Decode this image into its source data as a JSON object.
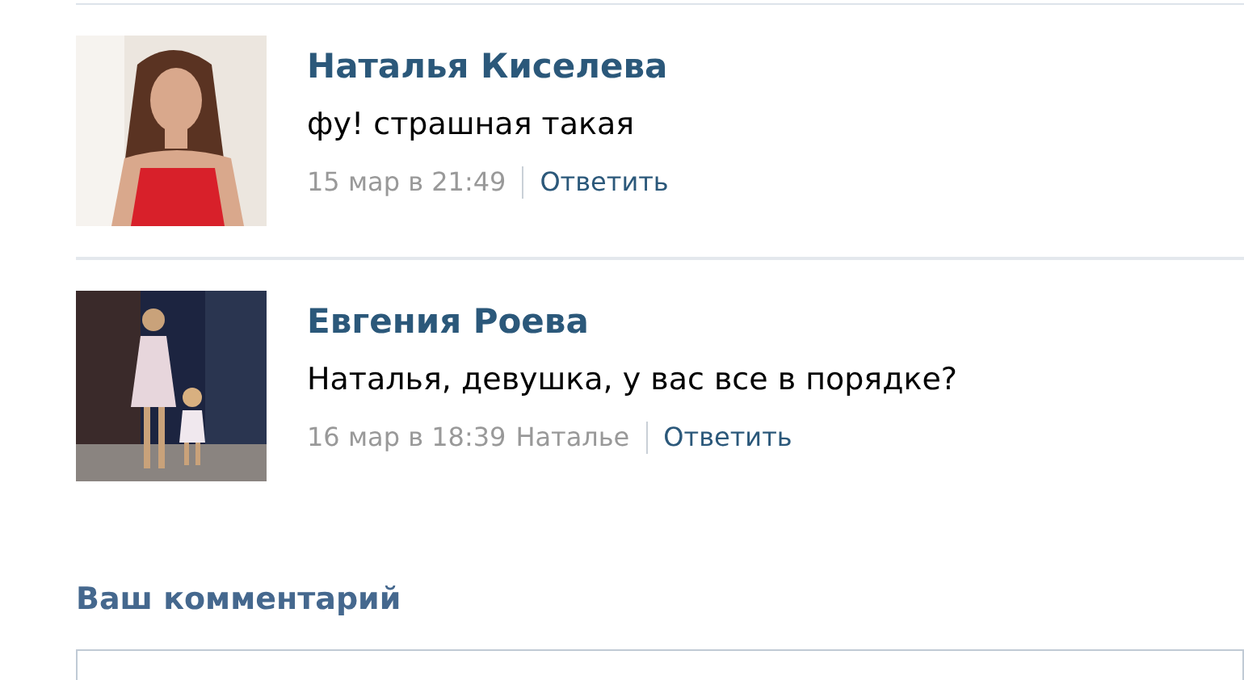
{
  "comments": [
    {
      "author": "Наталья Киселева",
      "text": "фу! страшная такая",
      "date": "15 мар в 21:49",
      "reply_label": "Ответить"
    },
    {
      "author": "Евгения Роева",
      "text": "Наталья, девушка, у вас все в порядке?",
      "date": "16 мар в 18:39",
      "reply_to": "Наталье",
      "reply_label": "Ответить"
    }
  ],
  "comment_form": {
    "title": "Ваш комментарий"
  }
}
